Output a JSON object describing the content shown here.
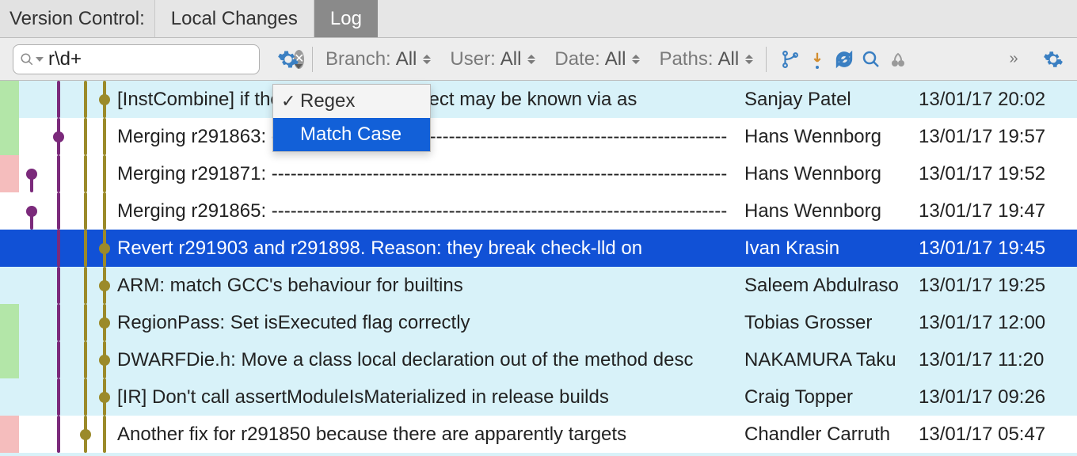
{
  "tabs": {
    "title": "Version Control:",
    "items": [
      "Local Changes",
      "Log"
    ],
    "active_index": 1
  },
  "toolbar": {
    "search_value": "r\\d+",
    "filters": {
      "branch_label": "Branch:",
      "branch_value": "All",
      "user_label": "User:",
      "user_value": "All",
      "date_label": "Date:",
      "date_value": "All",
      "paths_label": "Paths:",
      "paths_value": "All"
    },
    "options_dropdown": {
      "items": [
        "Regex",
        "Match Case"
      ],
      "checked_index": 0,
      "highlighted_index": 1
    }
  },
  "commits": [
    {
      "message": "[InstCombine] if the condition of a select may be known via as",
      "author": "Sanjay Patel",
      "date": "13/01/17 20:02",
      "highlight": true,
      "gutter": "green",
      "node_lane": 3,
      "node_color": "olive",
      "lanes": {
        "1": {
          "color": "purple"
        },
        "2": {
          "color": "olive"
        },
        "3": {
          "color": "olive",
          "top_only": false
        }
      }
    },
    {
      "message": "Merging r291863: ------------------------------------------------------------------------",
      "author": "Hans Wennborg",
      "date": "13/01/17 19:57",
      "highlight": false,
      "gutter": "green",
      "node_lane": 1,
      "node_color": "purple",
      "lanes": {
        "1": {
          "color": "purple"
        },
        "2": {
          "color": "olive"
        },
        "3": {
          "color": "olive"
        }
      }
    },
    {
      "message": "Merging r291871: ------------------------------------------------------------------------",
      "author": "Hans Wennborg",
      "date": "13/01/17 19:52",
      "highlight": false,
      "gutter": "red",
      "node_lane": 0,
      "node_color": "purple",
      "lanes": {
        "0": {
          "color": "purple",
          "top_only": true
        },
        "1": {
          "color": "purple"
        },
        "2": {
          "color": "olive"
        },
        "3": {
          "color": "olive"
        }
      }
    },
    {
      "message": "Merging r291865: ------------------------------------------------------------------------",
      "author": "Hans Wennborg",
      "date": "13/01/17 19:47",
      "highlight": false,
      "gutter": "",
      "node_lane": 0,
      "node_color": "purple",
      "lanes": {
        "0": {
          "color": "purple",
          "top_only": true
        },
        "1": {
          "color": "purple"
        },
        "2": {
          "color": "olive"
        },
        "3": {
          "color": "olive"
        }
      }
    },
    {
      "message": "Revert r291903 and r291898. Reason: they break check-lld on",
      "author": "Ivan Krasin",
      "date": "13/01/17 19:45",
      "highlight": true,
      "gutter": "",
      "selected": true,
      "node_lane": 3,
      "node_color": "olive",
      "lanes": {
        "1": {
          "color": "purple"
        },
        "2": {
          "color": "olive"
        },
        "3": {
          "color": "olive"
        }
      }
    },
    {
      "message": "ARM: match GCC's behaviour for builtins",
      "author": "Saleem Abdulraso",
      "date": "13/01/17 19:25",
      "highlight": true,
      "gutter": "",
      "node_lane": 3,
      "node_color": "olive",
      "lanes": {
        "1": {
          "color": "purple"
        },
        "2": {
          "color": "olive"
        },
        "3": {
          "color": "olive"
        }
      }
    },
    {
      "message": "RegionPass: Set isExecuted flag correctly",
      "author": "Tobias Grosser",
      "date": "13/01/17 12:00",
      "highlight": true,
      "gutter": "green",
      "node_lane": 3,
      "node_color": "olive",
      "lanes": {
        "1": {
          "color": "purple"
        },
        "2": {
          "color": "olive"
        },
        "3": {
          "color": "olive"
        }
      }
    },
    {
      "message": "DWARFDie.h: Move a class local declaration out of the method desc",
      "author": "NAKAMURA Taku",
      "date": "13/01/17 11:20",
      "highlight": true,
      "gutter": "green",
      "node_lane": 3,
      "node_color": "olive",
      "lanes": {
        "1": {
          "color": "purple"
        },
        "2": {
          "color": "olive"
        },
        "3": {
          "color": "olive"
        }
      }
    },
    {
      "message": "[IR] Don't call assertModuleIsMaterialized in release builds",
      "author": "Craig Topper",
      "date": "13/01/17 09:26",
      "highlight": true,
      "gutter": "",
      "node_lane": 3,
      "node_color": "olive",
      "lanes": {
        "1": {
          "color": "purple"
        },
        "2": {
          "color": "olive"
        },
        "3": {
          "color": "olive"
        }
      }
    },
    {
      "message": "Another fix for r291850 because there are apparently targets",
      "author": "Chandler Carruth",
      "date": "13/01/17 05:47",
      "highlight": false,
      "gutter": "red",
      "node_lane": 2,
      "node_color": "olive",
      "lanes": {
        "1": {
          "color": "purple"
        },
        "2": {
          "color": "olive"
        },
        "3": {
          "color": "olive"
        }
      }
    }
  ],
  "lane_x": {
    "0": 16,
    "1": 50,
    "2": 84,
    "3": 108
  }
}
